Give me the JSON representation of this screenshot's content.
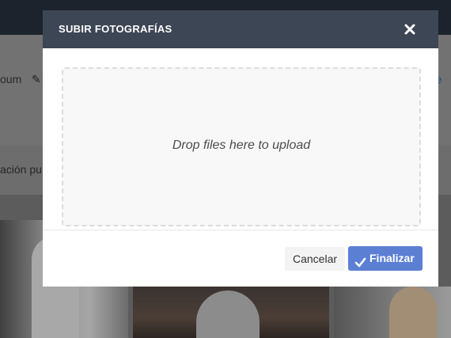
{
  "background": {
    "album_text": "oum",
    "link_text": "láe",
    "publication_text": "ación pu"
  },
  "modal": {
    "title": "SUBIR FOTOGRAFÍAS",
    "close_icon": "close-icon",
    "dropzone_text": "Drop files here to upload",
    "cancel_label": "Cancelar",
    "finish_label": "Finalizar",
    "finish_icon": "check-icon"
  },
  "colors": {
    "header": "#3d4654",
    "primary_button": "#5b7fd3",
    "topbar": "#1c232d"
  }
}
